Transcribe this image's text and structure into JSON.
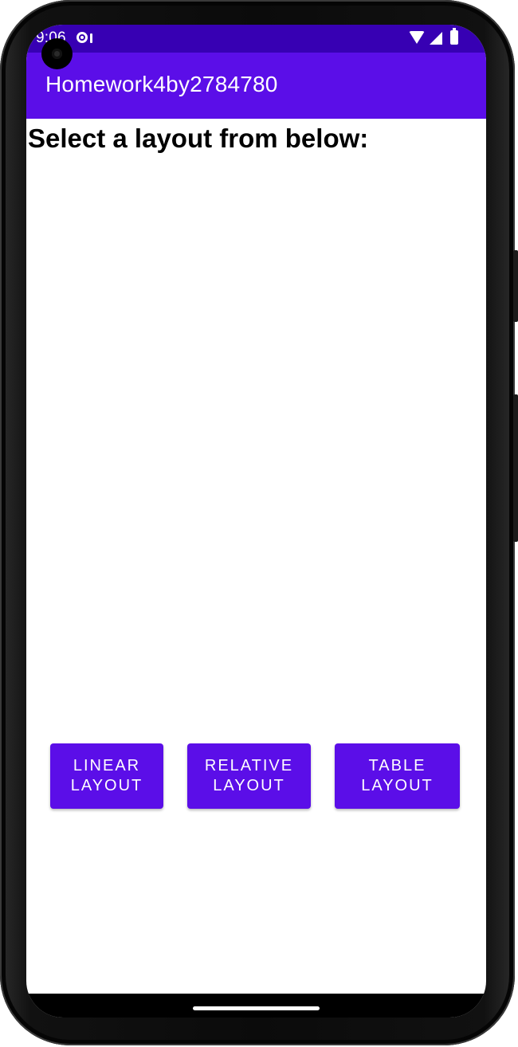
{
  "status_bar": {
    "time": "9:06",
    "icons": [
      "alert-icon",
      "wifi-icon",
      "signal-icon",
      "battery-icon"
    ]
  },
  "app_bar": {
    "title": "Homework4by2784780"
  },
  "main": {
    "heading": "Select a layout from below:",
    "buttons": [
      {
        "label": "LINEAR\nLAYOUT"
      },
      {
        "label": "RELATIVE\nLAYOUT"
      },
      {
        "label": "TABLE\nLAYOUT"
      }
    ]
  },
  "colors": {
    "status_bar": "#3700b3",
    "primary": "#5b0ee8",
    "background": "#ffffff"
  }
}
